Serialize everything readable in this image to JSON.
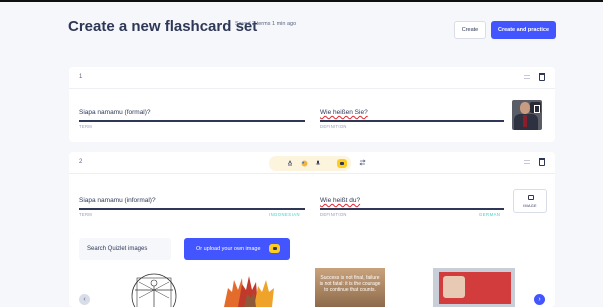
{
  "header": {
    "title": "Create a new flashcard set",
    "saved_status": "Saved 2 terms 1 min ago",
    "create_label": "Create",
    "create_practice_label": "Create and practice"
  },
  "cards": [
    {
      "number": "1",
      "term": "Siapa namamu (formal)?",
      "term_label": "TERM",
      "definition": "Wie heißen Sie?",
      "definition_label": "DEFINITION"
    },
    {
      "number": "2",
      "term": "Siapa namamu (informal)?",
      "term_label": "TERM",
      "term_language": "INDONESIAN",
      "definition": "Wie heißt du?",
      "definition_label": "DEFINITION",
      "definition_language": "GERMAN",
      "image_button_label": "IMAGE"
    }
  ],
  "image_search": {
    "search_placeholder": "Search Quizlet images",
    "upload_label": "Or upload your own image",
    "result_text": "Success is not final, failure is not fatal: it is the courage to continue that counts."
  },
  "colors": {
    "accent": "#4255ff",
    "language_tag": "#3ccfcf",
    "lock_badge": "#ffcd1f",
    "spellcheck": "#e0242b"
  }
}
